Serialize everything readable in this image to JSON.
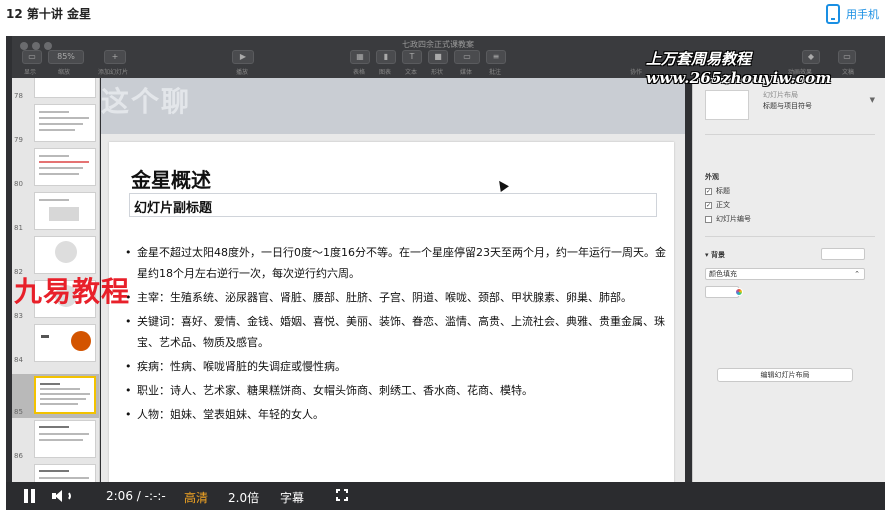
{
  "page": {
    "title": "12 第十讲 金星",
    "phone_link": "用手机"
  },
  "app": {
    "doc_title": "七政四余正式课教案",
    "toolbar_left": [
      {
        "icon": "view-icon",
        "label": "显示"
      },
      {
        "icon": "zoom",
        "label": "缩放",
        "value": "85%"
      },
      {
        "icon": "add-slide-icon",
        "label": "添加幻灯片"
      }
    ],
    "toolbar_center": [
      {
        "icon": "play-icon",
        "label": "播放"
      }
    ],
    "toolbar_right": [
      {
        "icon": "table-icon",
        "label": "表格"
      },
      {
        "icon": "chart-icon",
        "label": "图表"
      },
      {
        "icon": "text-icon",
        "label": "文本"
      },
      {
        "icon": "shape-icon",
        "label": "形状"
      },
      {
        "icon": "media-icon",
        "label": "媒体"
      },
      {
        "icon": "comment-icon",
        "label": "批注"
      },
      {
        "icon": "share-icon",
        "label": "协作"
      },
      {
        "icon": "tips-icon",
        "label": "提示"
      },
      {
        "icon": "format-icon",
        "label": "格式"
      },
      {
        "icon": "animate-icon",
        "label": "动画效果"
      },
      {
        "icon": "document-icon",
        "label": "文稿"
      }
    ]
  },
  "watermark": {
    "line1": "上万套周易教程",
    "line2": "www.265zhouyiw.com"
  },
  "slide_nav": {
    "thumbnails": [
      {
        "num": "78"
      },
      {
        "num": "79"
      },
      {
        "num": "80"
      },
      {
        "num": "81"
      },
      {
        "num": "82"
      },
      {
        "num": "83"
      },
      {
        "num": "84"
      },
      {
        "num": "85",
        "selected": true
      },
      {
        "num": "86"
      },
      {
        "num": "87"
      }
    ]
  },
  "canvas": {
    "ghost_title": "这个聊"
  },
  "slide": {
    "title": "金星概述",
    "subtitle": "幻灯片副标题",
    "bullets": [
      "金星不超过太阳48度外，一日行0度～1度16分不等。在一个星座停留23天至两个月，约一年运行一周天。金星约18个月左右逆行一次，每次逆行约六周。",
      "主宰：生殖系统、泌尿器官、肾脏、腰部、肚脐、子宫、阴道、喉咙、颈部、甲状腺素、卵巢、肺部。",
      "关键词：喜好、爱情、金钱、婚姻、喜悦、美丽、装饰、眷恋、滥情、高贵、上流社会、典雅、贵重金属、珠宝、艺术品、物质及感官。",
      "疾病：性病、喉咙肾脏的失调症或慢性病。",
      "职业：诗人、艺术家、糖果糕饼商、女帽头饰商、刺绣工、香水商、花商、模特。",
      "人物：姐妹、堂表姐妹、年轻的女人。"
    ]
  },
  "overlay_logo": "九易教程",
  "inspector": {
    "layout_title": "幻灯片布局",
    "layout_name": "标题与项目符号",
    "appearance_head": "外观",
    "checks": [
      {
        "label": "标题",
        "checked": true
      },
      {
        "label": "正文",
        "checked": true
      },
      {
        "label": "幻灯片编号",
        "checked": false
      }
    ],
    "background_head": "背景",
    "fill_select": "颜色填充",
    "edit_button": "编辑幻灯片布局"
  },
  "player": {
    "time": "2:06 / -:-:-",
    "quality": "高清",
    "speed": "2.0倍",
    "subtitles": "字幕",
    "quality_color": "#f5a623"
  }
}
